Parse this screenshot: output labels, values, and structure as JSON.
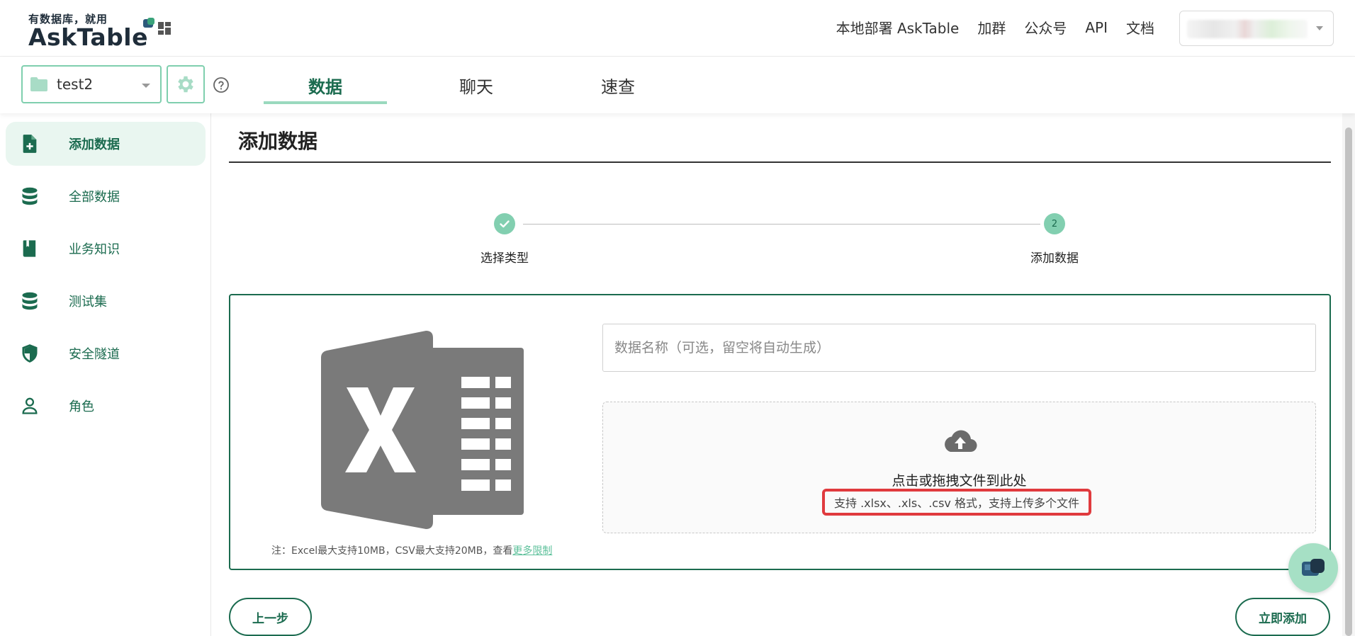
{
  "brand": {
    "tagline": "有数据库，就用",
    "name": "AskTable"
  },
  "top_nav": [
    {
      "label": "本地部署 AskTable"
    },
    {
      "label": "加群"
    },
    {
      "label": "公众号"
    },
    {
      "label": "API"
    },
    {
      "label": "文档"
    }
  ],
  "project": {
    "name": "test2"
  },
  "tabs": [
    {
      "label": "数据",
      "active": true
    },
    {
      "label": "聊天",
      "active": false
    },
    {
      "label": "速查",
      "active": false
    }
  ],
  "sidebar": {
    "items": [
      {
        "label": "添加数据",
        "icon": "file-add-icon",
        "active": true
      },
      {
        "label": "全部数据",
        "icon": "database-icon",
        "active": false
      },
      {
        "label": "业务知识",
        "icon": "book-icon",
        "active": false
      },
      {
        "label": "测试集",
        "icon": "database-icon",
        "active": false
      },
      {
        "label": "安全隧道",
        "icon": "shield-icon",
        "active": false
      },
      {
        "label": "角色",
        "icon": "user-icon",
        "active": false
      }
    ]
  },
  "main": {
    "title": "添加数据",
    "steps": [
      {
        "label": "选择类型",
        "status": "done",
        "number": ""
      },
      {
        "label": "添加数据",
        "status": "current",
        "number": "2"
      }
    ],
    "name_input": {
      "placeholder": "数据名称（可选，留空将自动生成）",
      "value": ""
    },
    "dropzone": {
      "title": "点击或拖拽文件到此处",
      "hint": "支持 .xlsx、.xls、.csv 格式，支持上传多个文件"
    },
    "note": {
      "text": "注：Excel最大支持10MB，CSV最大支持20MB，查看",
      "link": "更多限制"
    },
    "buttons": {
      "prev": "上一步",
      "submit": "立即添加"
    }
  },
  "colors": {
    "brand_green": "#1b6b4f",
    "accent_green": "#82cfb0",
    "active_bg": "#e9f6f0",
    "highlight_red": "#e03a3e",
    "excel_gray": "#7a7a7a"
  }
}
